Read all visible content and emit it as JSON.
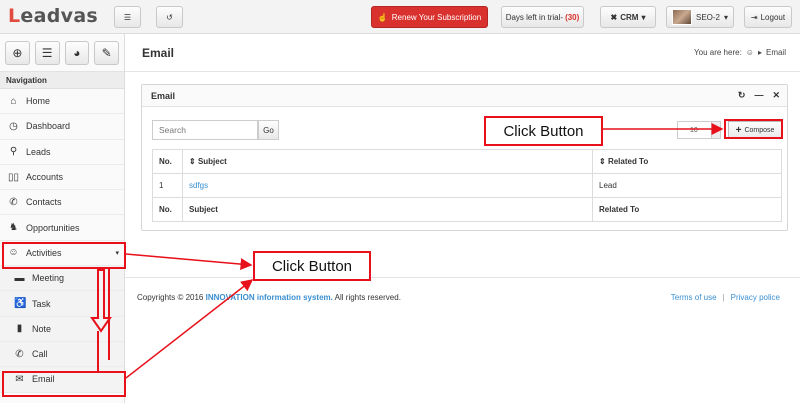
{
  "app": {
    "logo_prefix": "L",
    "logo_rest": "eadvas"
  },
  "topbar": {
    "renew_label": "Renew Your Subscription",
    "days_label": "Days left in trial-",
    "days_count": "(30)",
    "crm_label": "CRM",
    "user_label": "SEO-2",
    "logout_label": "Logout"
  },
  "sidebar": {
    "nav_title": "Navigation",
    "items": [
      {
        "label": "Home",
        "icon": "home-icon"
      },
      {
        "label": "Dashboard",
        "icon": "dashboard-icon"
      },
      {
        "label": "Leads",
        "icon": "leads-icon"
      },
      {
        "label": "Accounts",
        "icon": "accounts-icon"
      },
      {
        "label": "Contacts",
        "icon": "phone-icon"
      },
      {
        "label": "Opportunities",
        "icon": "opportunities-icon"
      },
      {
        "label": "Activities",
        "icon": "activities-icon"
      }
    ],
    "sub_items": [
      {
        "label": "Meeting",
        "icon": "meeting-icon"
      },
      {
        "label": "Task",
        "icon": "task-icon"
      },
      {
        "label": "Note",
        "icon": "note-icon"
      },
      {
        "label": "Call",
        "icon": "phone-icon"
      },
      {
        "label": "Email",
        "icon": "email-icon"
      }
    ]
  },
  "page": {
    "title": "Email",
    "breadcrumb_prefix": "You are here:",
    "breadcrumb_current": "Email"
  },
  "panel": {
    "title": "Email",
    "search_placeholder": "Search",
    "go_label": "Go",
    "per_page": "10",
    "compose_label": "Compose",
    "columns": [
      "No.",
      "Subject",
      "Related To"
    ],
    "rows": [
      {
        "no": "1",
        "subject": "sdfgs",
        "related": "Lead"
      }
    ]
  },
  "footer": {
    "copyright_prefix": "Copyrights © 2016",
    "company": "INNOVATION information system.",
    "copyright_suffix": "All rights reserved.",
    "terms": "Terms of use",
    "privacy": "Privacy police"
  },
  "annotations": {
    "callout_1": "Click Button",
    "callout_2": "Click Button"
  },
  "colors": {
    "accent_red": "#d9312d",
    "annotation_red": "#e8101a",
    "link_blue": "#3a8fd0"
  }
}
